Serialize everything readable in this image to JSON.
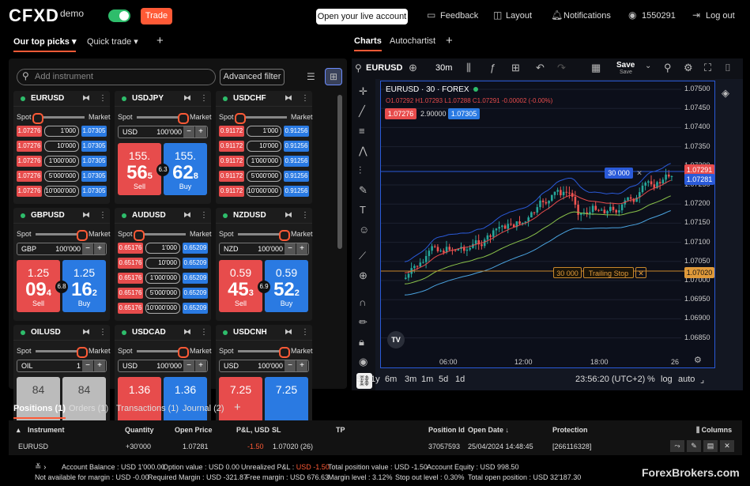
{
  "header": {
    "logo": "CFXD",
    "demo": "demo",
    "trade_label": "Trade",
    "live_account": "Open your live account",
    "feedback": "Feedback",
    "layout": "Layout",
    "notifications": "Notifications",
    "account_id": "1550291",
    "logout": "Log out"
  },
  "left_tabs": {
    "picks": "Our top picks",
    "quick": "Quick trade",
    "add": "+"
  },
  "right_tabs": {
    "charts": "Charts",
    "autochartist": "Autochartist",
    "add": "+"
  },
  "watchlist": {
    "search_placeholder": "Add instrument",
    "advanced_filter": "Advanced filter",
    "spot": "Spot",
    "market": "Market",
    "cards": [
      {
        "symbol": "EURUSD",
        "bids": [
          "1.07276",
          "1.07276",
          "1.07276",
          "1.07276",
          "1.07276"
        ],
        "vols": [
          "1'000",
          "10'000",
          "1'000'000",
          "5'000'000",
          "10'000'000"
        ],
        "asks": [
          "1.07305",
          "1.07305",
          "1.07305",
          "1.07305",
          "1.07305"
        ]
      },
      {
        "symbol": "USDJPY",
        "ccy": "USD",
        "amount": "100'000",
        "sell_top": "155.",
        "sell_big": "56",
        "sell_small": "5",
        "buy_top": "155.",
        "buy_big": "62",
        "buy_small": "8",
        "spread": "6.3",
        "sell": "Sell",
        "buy": "Buy"
      },
      {
        "symbol": "USDCHF",
        "bids": [
          "0.91172",
          "0.91172",
          "0.91172",
          "0.91172",
          "0.91172"
        ],
        "vols": [
          "1'000",
          "10'000",
          "1'000'000",
          "5'000'000",
          "10'000'000"
        ],
        "asks": [
          "0.91256",
          "0.91256",
          "0.91256",
          "0.91256",
          "0.91256"
        ]
      },
      {
        "symbol": "GBPUSD",
        "ccy": "GBP",
        "amount": "100'000",
        "sell_top": "1.25",
        "sell_big": "09",
        "sell_small": "4",
        "buy_top": "1.25",
        "buy_big": "16",
        "buy_small": "2",
        "spread": "6.8",
        "sell": "Sell",
        "buy": "Buy"
      },
      {
        "symbol": "AUDUSD",
        "bids": [
          "0.65176",
          "0.65176",
          "0.65176",
          "0.65176",
          "0.65176"
        ],
        "vols": [
          "1'000",
          "10'000",
          "1'000'000",
          "5'000'000",
          "10'000'000"
        ],
        "asks": [
          "0.65209",
          "0.65209",
          "0.65209",
          "0.65209",
          "0.65209"
        ]
      },
      {
        "symbol": "NZDUSD",
        "ccy": "NZD",
        "amount": "100'000",
        "sell_top": "0.59",
        "sell_big": "45",
        "sell_small": "3",
        "buy_top": "0.59",
        "buy_big": "52",
        "buy_small": "2",
        "spread": "6.9",
        "sell": "Sell",
        "buy": "Buy"
      },
      {
        "symbol": "OILUSD",
        "ccy": "OIL",
        "amount": "1",
        "sell_top": "84",
        "buy_top": "84"
      },
      {
        "symbol": "USDCAD",
        "ccy": "USD",
        "amount": "100'000",
        "sell_top": "1.36",
        "buy_top": "1.36"
      },
      {
        "symbol": "USDCNH",
        "ccy": "USD",
        "amount": "100'000",
        "sell_top": "7.25",
        "buy_top": "7.25"
      }
    ]
  },
  "chart": {
    "symbol": "EURUSD",
    "interval": "30m",
    "save": "Save",
    "save_sub": "Save",
    "legend_title": "EURUSD · 30 · FOREX",
    "ohlc": {
      "o": "1.07292",
      "h": "1.07293",
      "l": "1.07288",
      "c": "1.07291",
      "chg": "-0.00002 (-0.00%)"
    },
    "bid_pill": "1.07276",
    "spread_pill": "2.90000",
    "ask_pill": "1.07305",
    "order_label": "30 000",
    "trailing_qty": "30 000",
    "trailing_label": "Trailing Stop",
    "price_tag_red": "1.07291",
    "price_tag_blue": "1.07281",
    "price_tag_orange": "1.07020",
    "y_ticks": [
      "1.07500",
      "1.07450",
      "1.07400",
      "1.07350",
      "1.07300",
      "1.07250",
      "1.07200",
      "1.07150",
      "1.07100",
      "1.07050",
      "1.07000",
      "1.06950",
      "1.06900",
      "1.06850"
    ],
    "x_ticks": [
      "06:00",
      "12:00",
      "18:00",
      "26"
    ],
    "ranges": [
      "5y",
      "1y",
      "6m",
      "3m",
      "1m",
      "5d",
      "1d"
    ],
    "clock": "23:56:20 (UTC+2)",
    "pct": "%",
    "log": "log",
    "auto": "auto"
  },
  "positions": {
    "tabs": [
      "Positions (1)",
      "Orders (1)",
      "Transactions (1)",
      "Journal (2)",
      "+"
    ],
    "headers": {
      "instrument": "Instrument",
      "quantity": "Quantity",
      "open_price": "Open Price",
      "pl": "P&L, USD",
      "sl": "SL",
      "tp": "TP",
      "position_id": "Position Id",
      "open_date": "Open Date",
      "protection": "Protection",
      "columns": "Columns"
    },
    "row": {
      "instrument": "EURUSD",
      "quantity": "+30'000",
      "open_price": "1.07281",
      "pl": "-1.50",
      "sl": "1.07020 (26)",
      "position_id": "37057593",
      "open_date": "25/04/2024 14:48:45",
      "protection": "[266116328]"
    }
  },
  "status": {
    "balance": "Account Balance : USD 1'000.00",
    "option": "Option value : USD 0.00",
    "unreal_label": "Unrealized P&L :",
    "unreal": "USD -1.50",
    "total_pos": "Total position value : USD -1.50",
    "equity": "Account Equity : USD 998.50",
    "not_avail": "Not available for margin : USD -0.00",
    "req_margin": "Required Margin : USD -321.87",
    "free_margin": "Free margin : USD 676.63",
    "margin_level": "Margin level : 3.12%",
    "stop_out": "Stop out level : 0.30%",
    "total_open": "Total open position : USD 32'187.30",
    "watermark": "ForexBrokers.com"
  }
}
